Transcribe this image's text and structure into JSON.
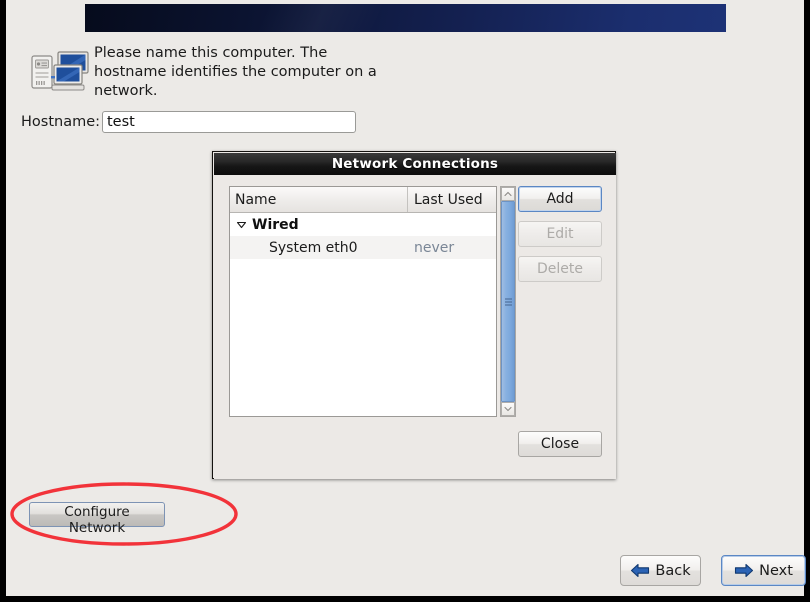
{
  "window": {
    "background_color": "#eceae7",
    "border_color": "#000000"
  },
  "banner": {
    "name": "installer-banner",
    "gradient_from": "#060b1c",
    "gradient_to": "#1d3276"
  },
  "intro": {
    "icon": "network-computers-icon",
    "text": "Please name this computer.  The hostname identifies the computer on a network."
  },
  "hostname": {
    "label": "Hostname:",
    "value": "test",
    "placeholder": ""
  },
  "actions": {
    "configure_network": "Configure Network",
    "back": "Back",
    "next": "Next",
    "back_icon": "arrow-left-icon",
    "next_icon": "arrow-right-icon"
  },
  "annotation": {
    "shape": "ellipse-highlight",
    "color": "#f2333a",
    "target": "Configure Network"
  },
  "dialog": {
    "title": "Network Connections",
    "columns": [
      "Name",
      "Last Used"
    ],
    "groups": [
      {
        "label": "Wired",
        "expanded": true,
        "expander_icon": "chevron-down-icon",
        "rows": [
          {
            "name": "System eth0",
            "last_used": "never"
          }
        ]
      }
    ],
    "buttons": {
      "add": {
        "label": "Add",
        "enabled": true
      },
      "edit": {
        "label": "Edit",
        "enabled": false
      },
      "delete": {
        "label": "Delete",
        "enabled": false
      },
      "close": {
        "label": "Close",
        "enabled": true
      }
    },
    "scrollbar": {
      "up_icon": "chevron-up-icon",
      "down_icon": "chevron-down-icon",
      "thumb_color": "#7ea9dd"
    }
  }
}
